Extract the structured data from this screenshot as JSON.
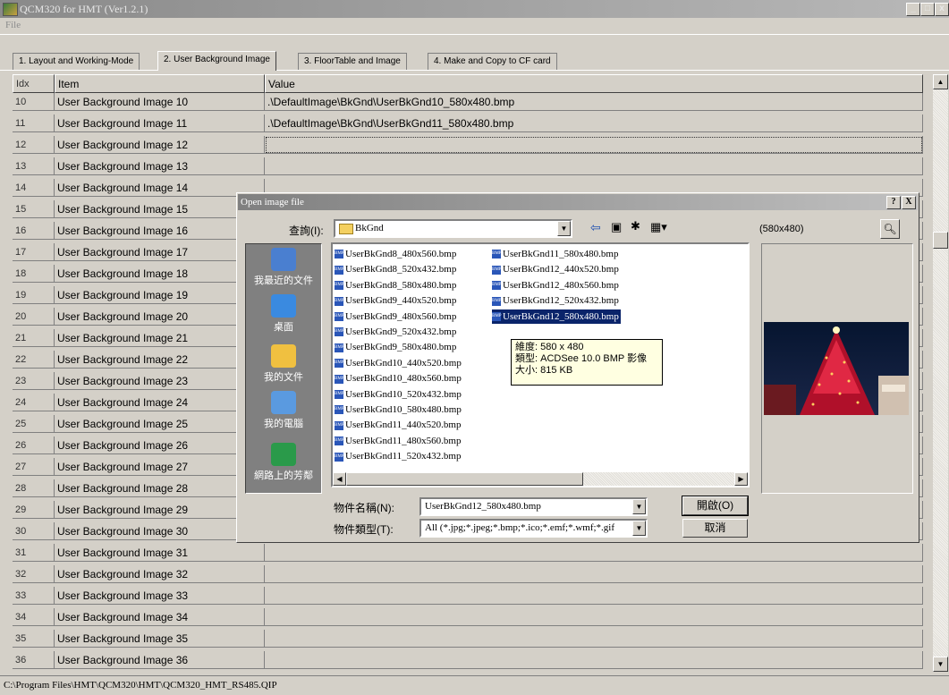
{
  "window": {
    "title": "QCM320 for HMT (Ver1.2.1)",
    "min": "_",
    "max": "□",
    "close": "x"
  },
  "menu": {
    "file": "File"
  },
  "tabs": [
    {
      "label": "1. Layout and Working-Mode"
    },
    {
      "label": "2. User Background Image"
    },
    {
      "label": "3. FloorTable and Image"
    },
    {
      "label": "4. Make and Copy to CF card"
    }
  ],
  "grid": {
    "headers": {
      "idx": "Idx",
      "item": "Item",
      "value": "Value"
    },
    "rows": [
      {
        "idx": "10",
        "item": "User Background Image 10",
        "value": ".\\DefaultImage\\BkGnd\\UserBkGnd10_580x480.bmp"
      },
      {
        "idx": "11",
        "item": "User Background Image 11",
        "value": ".\\DefaultImage\\BkGnd\\UserBkGnd11_580x480.bmp"
      },
      {
        "idx": "12",
        "item": "User Background Image 12",
        "value": ""
      },
      {
        "idx": "13",
        "item": "User Background Image 13",
        "value": ""
      },
      {
        "idx": "14",
        "item": "User Background Image 14",
        "value": ""
      },
      {
        "idx": "15",
        "item": "User Background Image 15",
        "value": ""
      },
      {
        "idx": "16",
        "item": "User Background Image 16",
        "value": ""
      },
      {
        "idx": "17",
        "item": "User Background Image 17",
        "value": ""
      },
      {
        "idx": "18",
        "item": "User Background Image 18",
        "value": ""
      },
      {
        "idx": "19",
        "item": "User Background Image 19",
        "value": ""
      },
      {
        "idx": "20",
        "item": "User Background Image 20",
        "value": ""
      },
      {
        "idx": "21",
        "item": "User Background Image 21",
        "value": ""
      },
      {
        "idx": "22",
        "item": "User Background Image 22",
        "value": ""
      },
      {
        "idx": "23",
        "item": "User Background Image 23",
        "value": ""
      },
      {
        "idx": "24",
        "item": "User Background Image 24",
        "value": ""
      },
      {
        "idx": "25",
        "item": "User Background Image 25",
        "value": ""
      },
      {
        "idx": "26",
        "item": "User Background Image 26",
        "value": ""
      },
      {
        "idx": "27",
        "item": "User Background Image 27",
        "value": ""
      },
      {
        "idx": "28",
        "item": "User Background Image 28",
        "value": ""
      },
      {
        "idx": "29",
        "item": "User Background Image 29",
        "value": ""
      },
      {
        "idx": "30",
        "item": "User Background Image 30",
        "value": ""
      },
      {
        "idx": "31",
        "item": "User Background Image 31",
        "value": ""
      },
      {
        "idx": "32",
        "item": "User Background Image 32",
        "value": ""
      },
      {
        "idx": "33",
        "item": "User Background Image 33",
        "value": ""
      },
      {
        "idx": "34",
        "item": "User Background Image 34",
        "value": ""
      },
      {
        "idx": "35",
        "item": "User Background Image 35",
        "value": ""
      },
      {
        "idx": "36",
        "item": "User Background Image 36",
        "value": ""
      }
    ]
  },
  "status": {
    "path": "C:\\Program Files\\HMT\\QCM320\\HMT\\QCM320_HMT_RS485.QIP"
  },
  "dialog": {
    "title": "Open image file",
    "help": "?",
    "close": "X",
    "lookin_label": "查詢(I):",
    "lookin_value": "BkGnd",
    "preview_size": "(580x480)",
    "places": [
      {
        "label": "我最近的文件",
        "icon": "recent-documents-icon"
      },
      {
        "label": "桌面",
        "icon": "desktop-icon"
      },
      {
        "label": "我的文件",
        "icon": "my-documents-icon"
      },
      {
        "label": "我的電腦",
        "icon": "my-computer-icon"
      },
      {
        "label": "網路上的芳鄰",
        "icon": "network-places-icon"
      }
    ],
    "files_col1": [
      "UserBkGnd8_480x560.bmp",
      "UserBkGnd8_520x432.bmp",
      "UserBkGnd8_580x480.bmp",
      "UserBkGnd9_440x520.bmp",
      "UserBkGnd9_480x560.bmp",
      "UserBkGnd9_520x432.bmp",
      "UserBkGnd9_580x480.bmp",
      "UserBkGnd10_440x520.bmp",
      "UserBkGnd10_480x560.bmp",
      "UserBkGnd10_520x432.bmp",
      "UserBkGnd10_580x480.bmp",
      "UserBkGnd11_440x520.bmp",
      "UserBkGnd11_480x560.bmp",
      "UserBkGnd11_520x432.bmp"
    ],
    "files_col2": [
      "UserBkGnd11_580x480.bmp",
      "UserBkGnd12_440x520.bmp",
      "UserBkGnd12_480x560.bmp",
      "UserBkGnd12_520x432.bmp",
      "UserBkGnd12_580x480.bmp"
    ],
    "selected_file": "UserBkGnd12_580x480.bmp",
    "file_icon_text": "BMP",
    "tooltip": {
      "line1": "維度: 580 x 480",
      "line2": "類型: ACDSee 10.0 BMP 影像",
      "line3": "大小: 815 KB"
    },
    "filename_label": "物件名稱(N):",
    "filename_value": "UserBkGnd12_580x480.bmp",
    "filetype_label": "物件類型(T):",
    "filetype_value": "All (*.jpg;*.jpeg;*.bmp;*.ico;*.emf;*.wmf;*.gif",
    "open_button": "開啟(O)",
    "cancel_button": "取消"
  }
}
